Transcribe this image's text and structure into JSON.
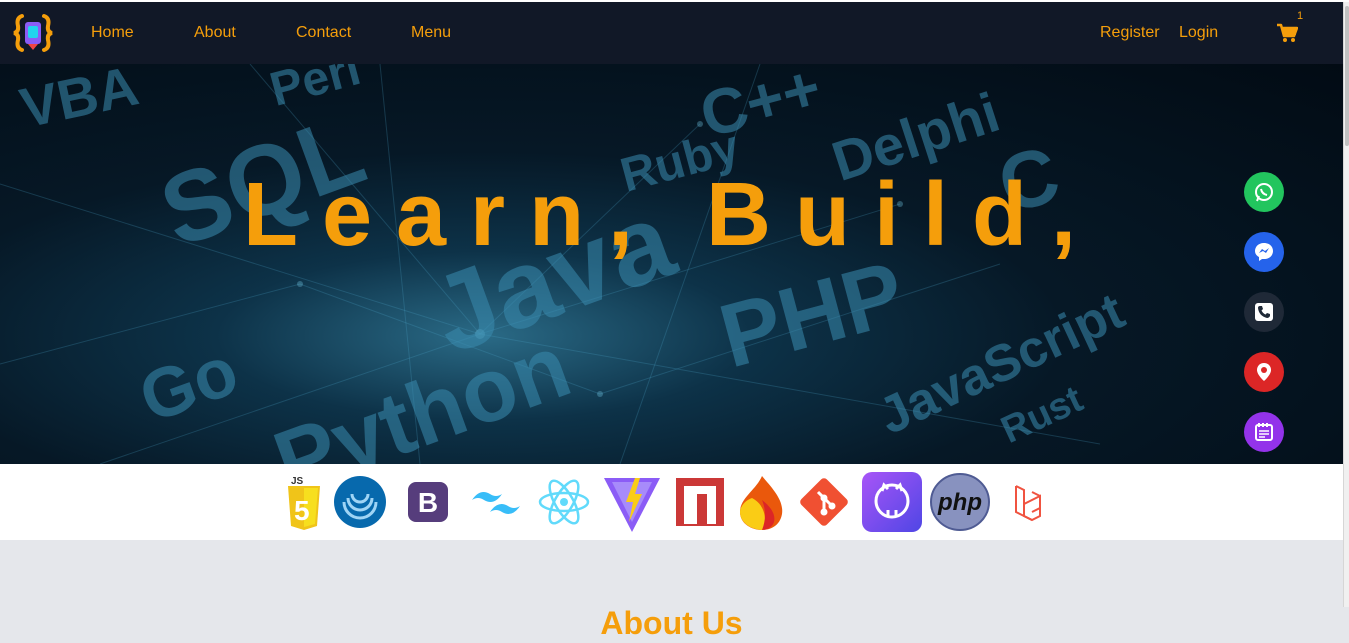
{
  "nav": {
    "links": [
      "Home",
      "About",
      "Contact",
      "Menu"
    ],
    "register": "Register",
    "login": "Login",
    "cart_count": "1",
    "cart_icon": "shopping-cart-icon"
  },
  "hero": {
    "headline": "Learn, Build,",
    "background_words": [
      "VBA",
      "Perl",
      "SQL",
      "Ruby",
      "C++",
      "Delphi",
      "Java",
      "PHP",
      "Python",
      "Go",
      "JavaScript",
      "Rust",
      "C"
    ]
  },
  "floating_contacts": [
    {
      "name": "whatsapp",
      "color": "#22c55e"
    },
    {
      "name": "messenger",
      "color": "#2563eb"
    },
    {
      "name": "phone",
      "color": "#1f2937"
    },
    {
      "name": "location",
      "color": "#dc2626"
    },
    {
      "name": "notes",
      "color": "#9333ea"
    }
  ],
  "tech_stack": [
    "javascript",
    "jquery",
    "bootstrap",
    "tailwind",
    "react",
    "vite",
    "npm",
    "firebase",
    "git",
    "github",
    "php",
    "laravel"
  ],
  "bootstrap_letter": "B",
  "php_text": "php",
  "js_text": "JS",
  "about": {
    "heading": "About Us"
  },
  "colors": {
    "accent": "#f59e0b",
    "nav_bg": "#111827",
    "page_bg": "#e5e7eb"
  }
}
